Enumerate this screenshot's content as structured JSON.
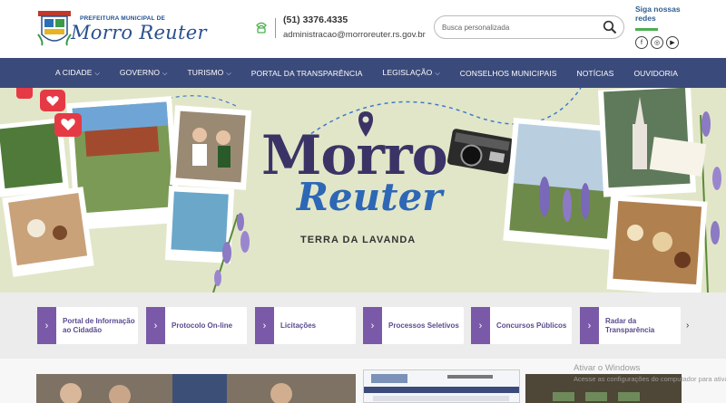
{
  "header": {
    "municipality_label": "PREFEITURA MUNICIPAL DE",
    "city_name": "Morro Reuter",
    "phone": "(51) 3376.4335",
    "email": "administracao@morroreuter.rs.gov.br",
    "search_placeholder": "Busca personalizada",
    "social_title": "Siga nossas redes",
    "social_icons": [
      "facebook-icon",
      "instagram-icon",
      "youtube-icon"
    ]
  },
  "nav": {
    "items": [
      {
        "label": "A CIDADE",
        "dropdown": true
      },
      {
        "label": "GOVERNO",
        "dropdown": true
      },
      {
        "label": "TURISMO",
        "dropdown": true
      },
      {
        "label": "PORTAL DA TRANSPARÊNCIA",
        "dropdown": false
      },
      {
        "label": "LEGISLAÇÃO",
        "dropdown": true
      },
      {
        "label": "CONSELHOS MUNICIPAIS",
        "dropdown": false
      },
      {
        "label": "NOTÍCIAS",
        "dropdown": false
      },
      {
        "label": "OUVIDORIA",
        "dropdown": false
      }
    ]
  },
  "banner": {
    "title_line1": "Morro",
    "title_line2": "Reuter",
    "tagline": "TERRA DA LAVANDA",
    "prev_label": "←",
    "next_label": "→"
  },
  "quick_links": {
    "items": [
      {
        "label": "Portal de Informação ao Cidadão"
      },
      {
        "label": "Protocolo On-line"
      },
      {
        "label": "Licitações"
      },
      {
        "label": "Processos Seletivos"
      },
      {
        "label": "Concursos Públicos"
      },
      {
        "label": "Radar da Transparência"
      }
    ],
    "next_label": "›"
  },
  "watermark": {
    "title": "Ativar o Windows",
    "subtitle": "Acesse as configurações do computador para ativar"
  },
  "colors": {
    "nav_bg": "#3a4a7a",
    "accent_purple": "#7a5aa8",
    "banner_bg": "#e2e6c8",
    "brand_blue": "#2d67b5"
  }
}
